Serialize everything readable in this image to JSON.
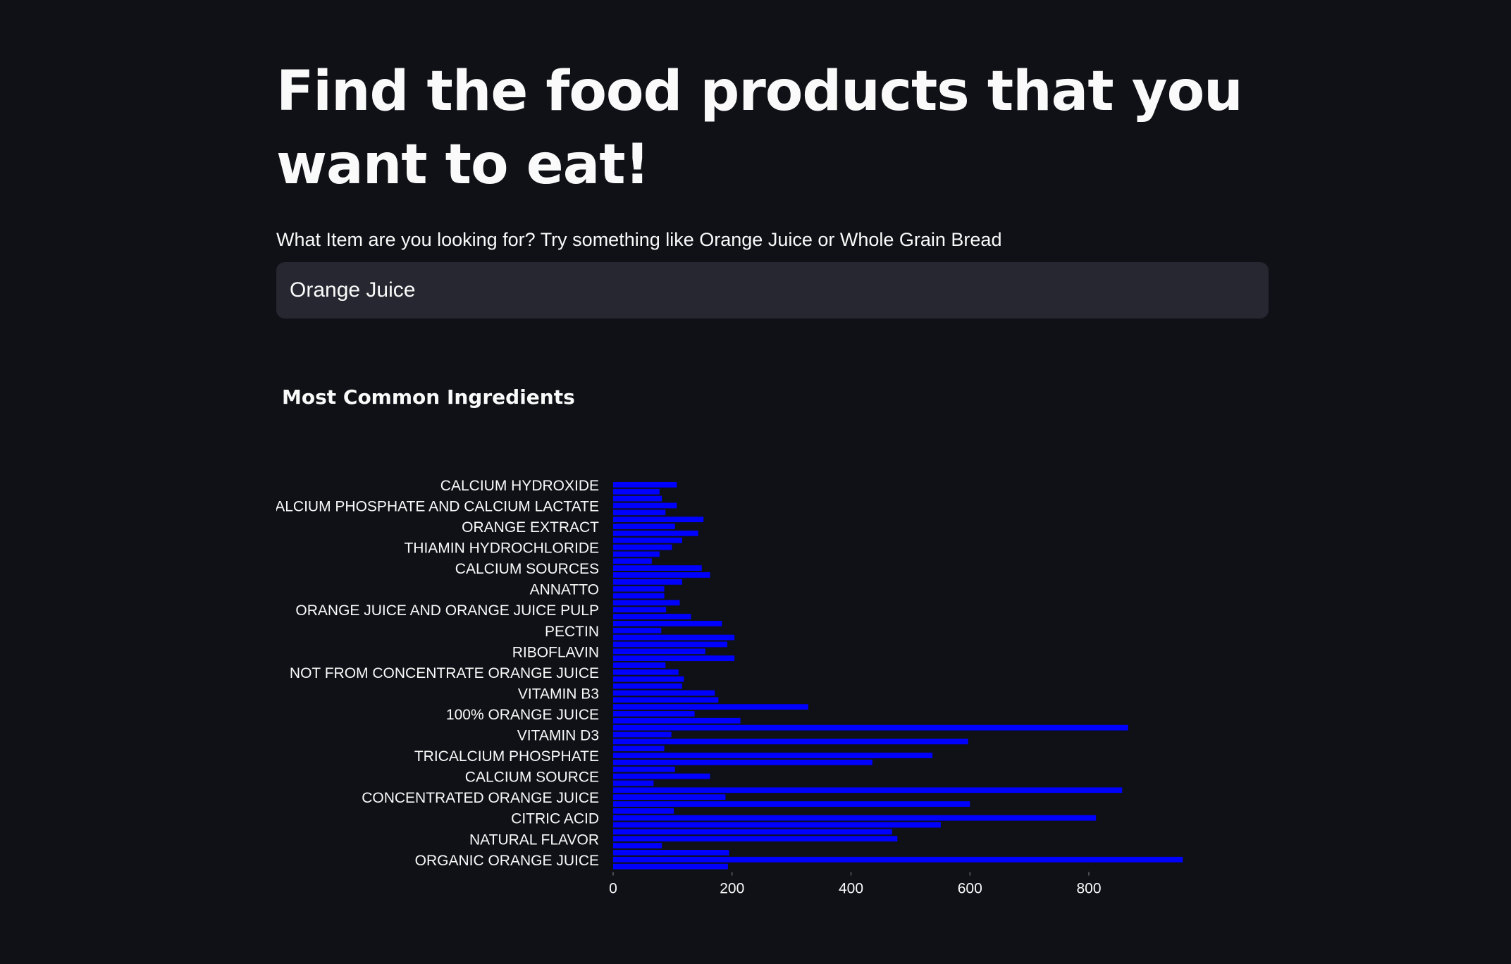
{
  "page": {
    "title": "Find the food products that you want to eat!",
    "search_label": "What Item are you looking for? Try something like Orange Juice or Whole Grain Bread",
    "search_value": "Orange Juice"
  },
  "colors": {
    "background": "#0f1116",
    "text": "#fafafa",
    "input_background": "#262730",
    "bar": "#0000ff"
  },
  "chart_data": {
    "type": "bar",
    "orientation": "horizontal",
    "title": "Most Common Ingredients",
    "xlabel": "",
    "ylabel": "",
    "xlim": [
      0,
      960
    ],
    "x_ticks": [
      0,
      200,
      400,
      600,
      800
    ],
    "grid": false,
    "legend": "none",
    "bars_top_to_bottom": [
      {
        "label": "CALCIUM HYDROXIDE",
        "value": 107
      },
      {
        "label": "",
        "value": 78
      },
      {
        "label": "",
        "value": 82
      },
      {
        "label": "CALCIUM PHOSPHATE AND CALCIUM LACTATE",
        "value": 107
      },
      {
        "label": "",
        "value": 88
      },
      {
        "label": "",
        "value": 152
      },
      {
        "label": "ORANGE EXTRACT",
        "value": 104
      },
      {
        "label": "",
        "value": 143
      },
      {
        "label": "",
        "value": 116
      },
      {
        "label": "THIAMIN HYDROCHLORIDE",
        "value": 99
      },
      {
        "label": "",
        "value": 78
      },
      {
        "label": "",
        "value": 65
      },
      {
        "label": "CALCIUM SOURCES",
        "value": 149
      },
      {
        "label": "",
        "value": 163
      },
      {
        "label": "",
        "value": 116
      },
      {
        "label": "ANNATTO",
        "value": 86
      },
      {
        "label": "",
        "value": 86
      },
      {
        "label": "",
        "value": 112
      },
      {
        "label": "ORANGE JUICE AND ORANGE JUICE PULP",
        "value": 89
      },
      {
        "label": "",
        "value": 131
      },
      {
        "label": "",
        "value": 183
      },
      {
        "label": "PECTIN",
        "value": 81
      },
      {
        "label": "",
        "value": 204
      },
      {
        "label": "",
        "value": 192
      },
      {
        "label": "RIBOFLAVIN",
        "value": 155
      },
      {
        "label": "",
        "value": 204
      },
      {
        "label": "",
        "value": 88
      },
      {
        "label": "NOT FROM CONCENTRATE ORANGE JUICE",
        "value": 110
      },
      {
        "label": "",
        "value": 119
      },
      {
        "label": "",
        "value": 116
      },
      {
        "label": "VITAMIN B3",
        "value": 171
      },
      {
        "label": "",
        "value": 177
      },
      {
        "label": "",
        "value": 328
      },
      {
        "label": "100% ORANGE JUICE",
        "value": 137
      },
      {
        "label": "",
        "value": 214
      },
      {
        "label": "",
        "value": 866
      },
      {
        "label": "VITAMIN D3",
        "value": 98
      },
      {
        "label": "",
        "value": 597
      },
      {
        "label": "",
        "value": 86
      },
      {
        "label": "TRICALCIUM PHOSPHATE",
        "value": 537
      },
      {
        "label": "",
        "value": 436
      },
      {
        "label": "",
        "value": 104
      },
      {
        "label": "CALCIUM SOURCE",
        "value": 163
      },
      {
        "label": "",
        "value": 68
      },
      {
        "label": "",
        "value": 856
      },
      {
        "label": "CONCENTRATED ORANGE JUICE",
        "value": 189
      },
      {
        "label": "",
        "value": 600
      },
      {
        "label": "",
        "value": 102
      },
      {
        "label": "CITRIC ACID",
        "value": 812
      },
      {
        "label": "",
        "value": 551
      },
      {
        "label": "",
        "value": 469
      },
      {
        "label": "NATURAL FLAVOR",
        "value": 478
      },
      {
        "label": "",
        "value": 82
      },
      {
        "label": "",
        "value": 195
      },
      {
        "label": "ORGANIC ORANGE JUICE",
        "value": 958
      },
      {
        "label": "",
        "value": 193
      }
    ]
  }
}
